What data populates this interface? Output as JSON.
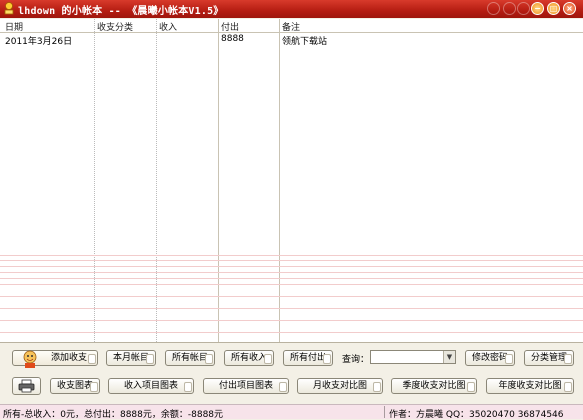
{
  "window": {
    "title": "lhdown 的小帐本 -- 《晨曦小帐本V1.5》"
  },
  "grid": {
    "columns": [
      "日期",
      "收支分类",
      "收入",
      "付出",
      "备注"
    ],
    "rows": [
      {
        "date": "2011年3月26日",
        "category": "",
        "income": "",
        "expense": "8888",
        "note": "领航下载站"
      }
    ]
  },
  "toolbar": {
    "add_label": "添加收支",
    "month_label": "本月帐目",
    "all_accounts_label": "所有帐目",
    "all_income_label": "所有收入",
    "all_expense_label": "所有付出",
    "query_label": "查询：",
    "query_value": "",
    "change_password_label": "修改密码",
    "category_manage_label": "分类管理",
    "chart_label": "收支图表",
    "income_chart_label": "收入项目图表",
    "expense_chart_label": "付出项目图表",
    "month_compare_label": "月收支对比图",
    "quarter_compare_label": "季度收支对比图",
    "year_compare_label": "年度收支对比图"
  },
  "status": {
    "summary": "所有-总收入：0元，总付出：8888元，余额：-8888元",
    "author": "作者：方晨曦  QQ：35020470  36874546"
  },
  "colors": {
    "titlebar": "#c0281b",
    "status_bg": "#f7e3ea",
    "row_line": "#f2cccc"
  }
}
